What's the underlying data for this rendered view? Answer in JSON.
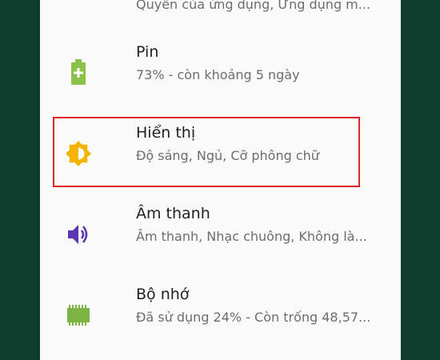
{
  "settings": {
    "top_partial_subtitle": "Quyền của ứng dụng, Ứng dụng m...",
    "items": [
      {
        "title": "Pin",
        "subtitle": "73% - còn khoảng 5 ngày",
        "icon": "battery-icon",
        "color": "#8bc34a"
      },
      {
        "title": "Hiển thị",
        "subtitle": "Độ sáng, Ngủ, Cỡ phông chữ",
        "icon": "brightness-icon",
        "color": "#f5b400"
      },
      {
        "title": "Âm thanh",
        "subtitle": "Âm thanh, Nhạc chuông, Không là...",
        "icon": "volume-icon",
        "color": "#5e35b1"
      },
      {
        "title": "Bộ nhớ",
        "subtitle": "Đã sử dụng 24% - Còn trống 48,57...",
        "icon": "memory-icon",
        "color": "#7cb342"
      }
    ],
    "highlight_color": "#e0242b"
  }
}
